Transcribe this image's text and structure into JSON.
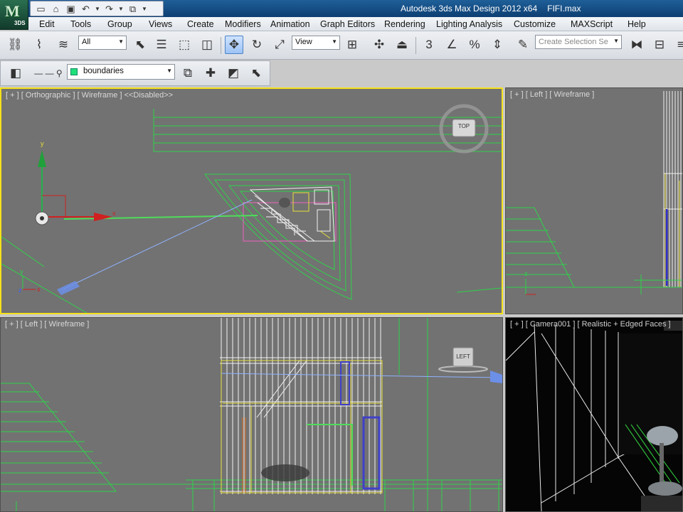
{
  "app": {
    "logo_text": "3DS",
    "title": "Autodesk 3ds Max Design 2012 x64",
    "file": "FIFI.max"
  },
  "quick_access": {
    "icons": [
      "new-file-icon",
      "open-file-icon",
      "save-icon",
      "undo-icon",
      "redo-icon",
      "project-folder-icon"
    ]
  },
  "menu": [
    "Edit",
    "Tools",
    "Group",
    "Views",
    "Create",
    "Modifiers",
    "Animation",
    "Graph Editors",
    "Rendering",
    "Lighting Analysis",
    "Customize",
    "MAXScript",
    "Help"
  ],
  "toolbar": {
    "filter_value": "All",
    "ref_coord_value": "View",
    "snap_value": "3",
    "selection_set_placeholder": "Create Selection Se"
  },
  "layer": {
    "current": "boundaries",
    "color": "#1fe07a"
  },
  "viewports": {
    "top": {
      "label": "[ + ] [ Orthographic ] [ Wireframe ] <<Disabled>>",
      "cube": "TOP"
    },
    "left1": {
      "label": "[ + ] [ Left ] [ Wireframe ]"
    },
    "left2": {
      "label": "[ + ] [ Left ] [ Wireframe ]",
      "cube": "LEFT"
    },
    "camera": {
      "label": "[ + ] [ Camera001 ] [ Realistic + Edged Faces ]"
    }
  },
  "colors": {
    "active_border": "#f5e11a",
    "viewport_bg": "#727272",
    "wire_green": "#2fd24a",
    "wire_white": "#f2f2f2",
    "wire_yellow": "#e8e03a",
    "wire_blue": "#8fb2ff"
  }
}
